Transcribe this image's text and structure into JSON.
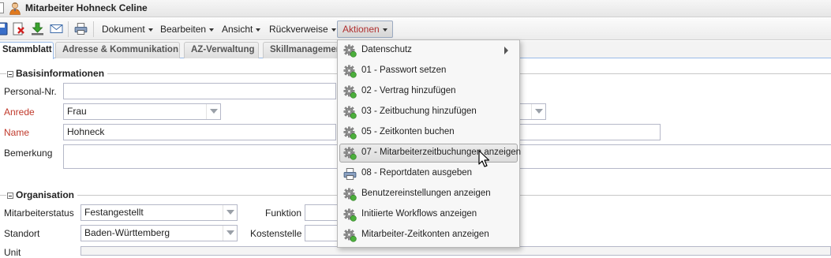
{
  "window": {
    "title": "Mitarbeiter Hohneck Celine",
    "user_icon": "user-icon"
  },
  "toolbar": {
    "icons": [
      "save-icon",
      "delete-icon",
      "download-icon",
      "mail-icon",
      "print-icon"
    ],
    "menus": [
      "Dokument",
      "Bearbeiten",
      "Ansicht",
      "Rückverweise",
      "Aktionen"
    ],
    "active_menu": "Aktionen"
  },
  "tabs": [
    "Stammblatt",
    "Adresse & Kommunikation",
    "AZ-Verwaltung",
    "Skillmanagement"
  ],
  "active_tab": "Stammblatt",
  "basis": {
    "title": "Basisinformationen",
    "personal_nr_label": "Personal-Nr.",
    "personal_nr_value": "",
    "anrede_label": "Anrede",
    "anrede_value": "Frau",
    "name_label": "Name",
    "name_value": "Hohneck",
    "bemerkung_label": "Bemerkung",
    "bemerkung_value": ""
  },
  "organisation": {
    "title": "Organisation",
    "status_label": "Mitarbeiterstatus",
    "status_value": "Festangestellt",
    "funktion_label": "Funktion",
    "standort_label": "Standort",
    "standort_value": "Baden-Württemberg",
    "kostenstelle_label": "Kostenstelle",
    "unit_label": "Unit"
  },
  "actions_menu": {
    "items": [
      {
        "label": "Datenschutz",
        "icon": "gear-icon",
        "submenu": true
      },
      {
        "label": "01 - Passwort setzen",
        "icon": "gear-icon"
      },
      {
        "label": "02 - Vertrag hinzufügen",
        "icon": "gear-icon"
      },
      {
        "label": "03 - Zeitbuchung hinzufügen",
        "icon": "gear-icon"
      },
      {
        "label": "05 - Zeitkonten buchen",
        "icon": "gear-icon"
      },
      {
        "label": "07 - Mitarbeiterzeitbuchungen anzeigen",
        "icon": "gear-icon",
        "hover": true
      },
      {
        "label": "08 - Reportdaten ausgeben",
        "icon": "print-icon"
      },
      {
        "label": "Benutzereinstellungen anzeigen",
        "icon": "gear-icon"
      },
      {
        "label": "Initiierte Workflows anzeigen",
        "icon": "gear-icon"
      },
      {
        "label": "Mitarbeiter-Zeitkonten anzeigen",
        "icon": "gear-icon"
      }
    ]
  },
  "colors": {
    "required_label": "#c0392b",
    "active_menu_text": "#b03030",
    "tab_border": "#99bbe8"
  }
}
